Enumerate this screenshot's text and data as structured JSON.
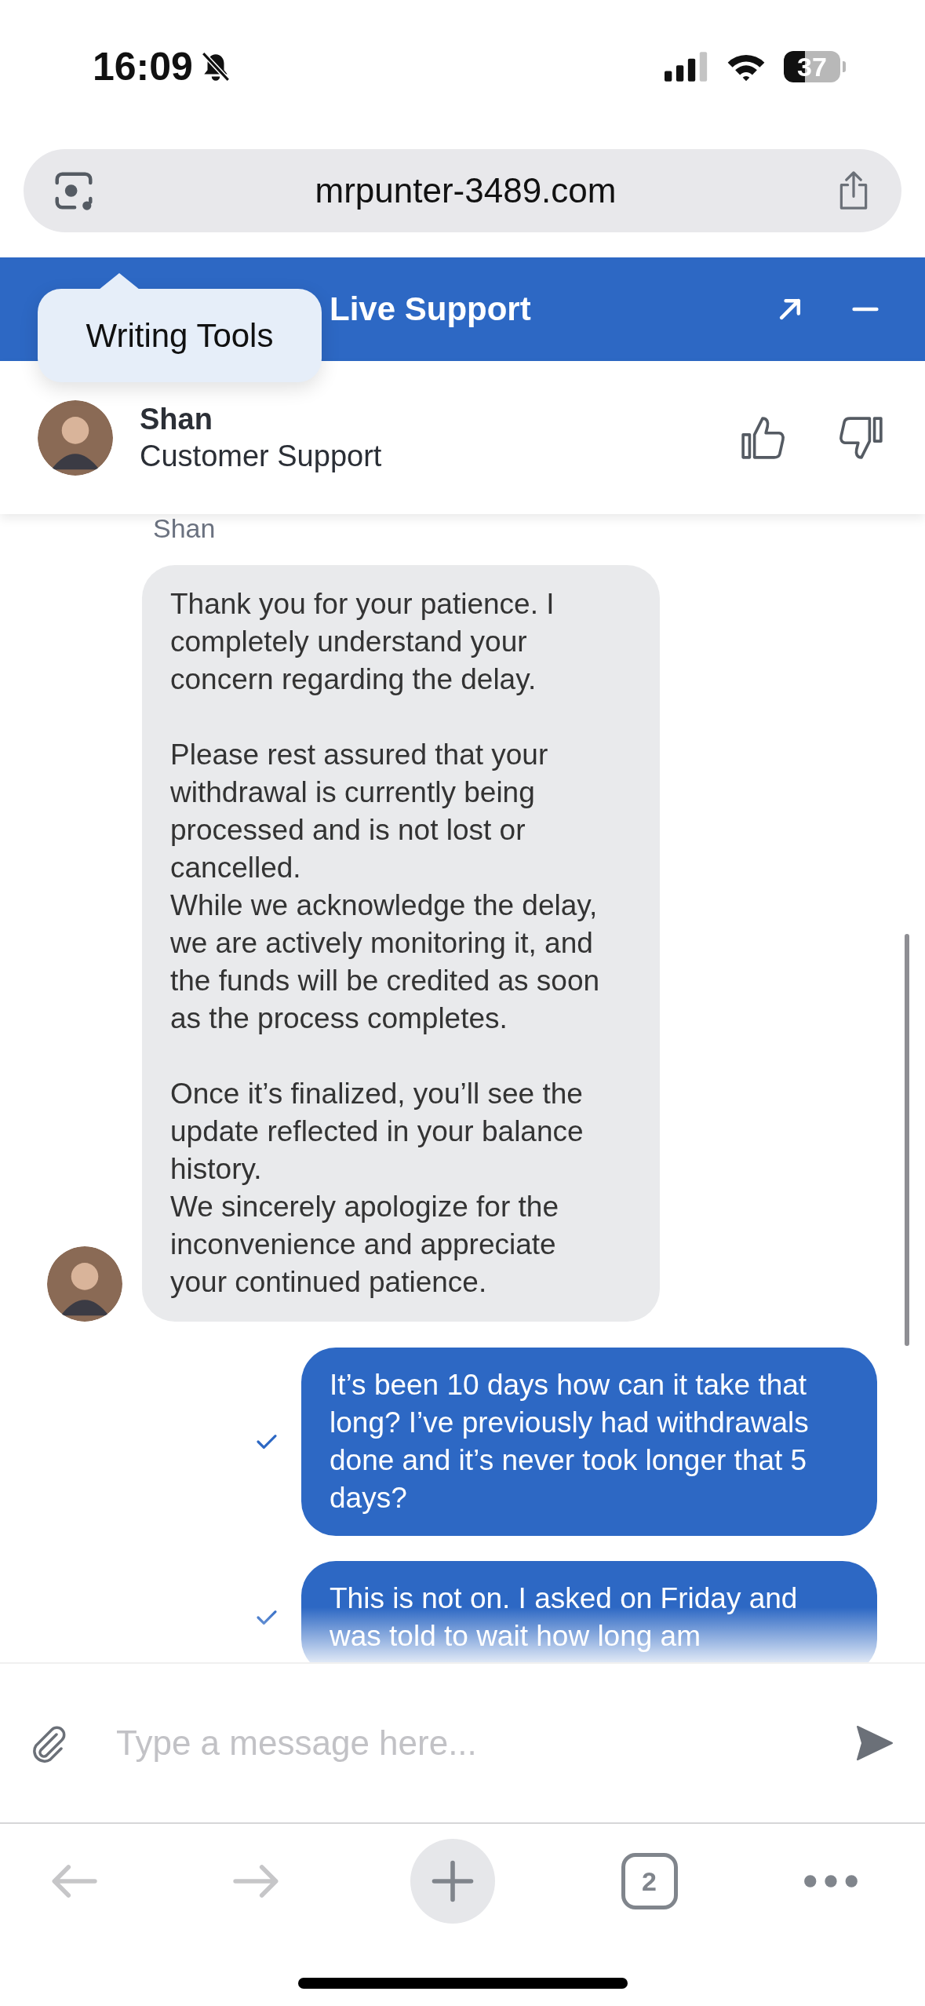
{
  "status_bar": {
    "time": "16:09",
    "battery": "37"
  },
  "address_bar": {
    "url": "mrpunter-3489.com"
  },
  "chat_header": {
    "title": "Live Support"
  },
  "popover": {
    "label": "Writing Tools"
  },
  "agent": {
    "name": "Shan",
    "role": "Customer Support"
  },
  "messages": [
    {
      "kind": "agent",
      "sender": "Shan",
      "text": "Thank you for your patience. I completely understand your concern regarding the delay.\n\nPlease rest assured that your withdrawal is currently being processed and is not lost or cancelled.\nWhile we acknowledge the delay, we are actively monitoring it, and the funds will be credited as soon as the process completes.\n\nOnce it’s finalized, you’ll see the update reflected in your balance history.\nWe sincerely apologize for the inconvenience and appreciate your continued patience."
    },
    {
      "kind": "user",
      "delivered": true,
      "text": "It’s been 10 days how can it take that long? I’ve previously had withdrawals done and it’s never took longer that 5 days?"
    },
    {
      "kind": "user",
      "delivered": true,
      "text": "This is not on. I asked on Friday and was told to wait how long am"
    }
  ],
  "composer": {
    "placeholder": "Type a message here..."
  },
  "toolbar": {
    "tab_count": "2"
  }
}
